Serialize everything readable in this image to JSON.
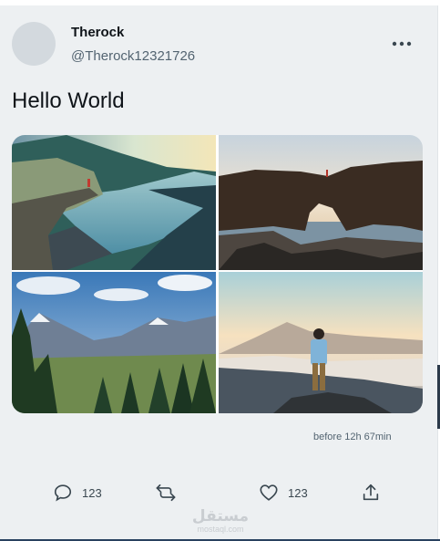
{
  "tweet": {
    "display_name": "Therock",
    "handle": "@Therock12321726",
    "text": "Hello World",
    "timestamp": "before 12h 67min",
    "more_icon": "more-horizontal-icon"
  },
  "media": [
    {
      "name": "cliff-over-fjord-photo"
    },
    {
      "name": "rock-arch-sea-photo"
    },
    {
      "name": "mountain-forest-valley-photo"
    },
    {
      "name": "hiker-on-summit-photo"
    }
  ],
  "actions": {
    "reply": {
      "icon": "reply-icon",
      "count": "123"
    },
    "retweet": {
      "icon": "retweet-icon"
    },
    "like": {
      "icon": "heart-icon",
      "count": "123"
    },
    "share": {
      "icon": "share-icon"
    }
  },
  "watermark": {
    "main": "مستقل",
    "sub": "mostaql.com"
  },
  "colors": {
    "card_background": "#edf0f2",
    "text_primary": "#0f1419",
    "text_secondary": "#536471"
  }
}
